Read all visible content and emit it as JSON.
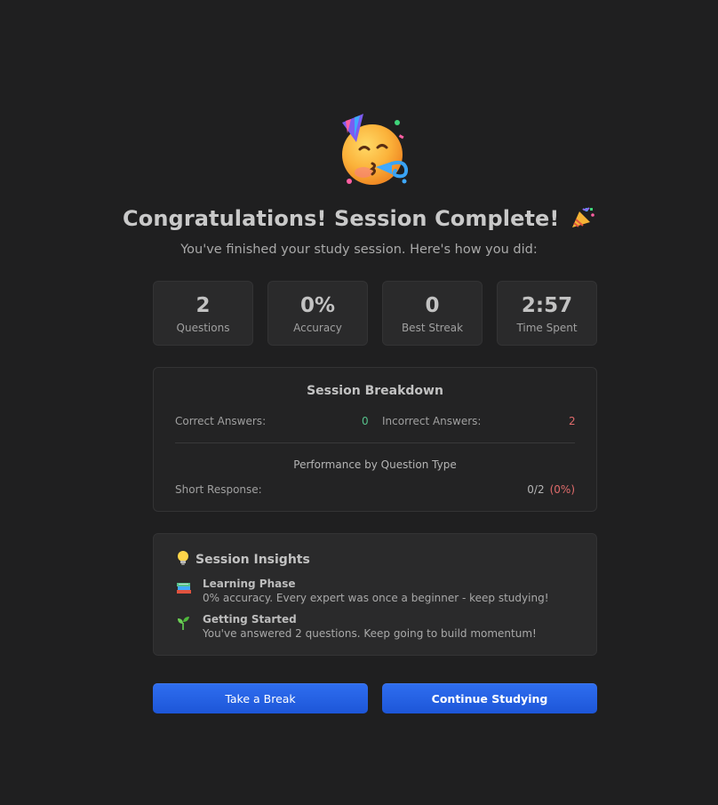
{
  "colors": {
    "background": "#1f1f20",
    "card": "#2a2a2b",
    "accent_blue": "#2563eb",
    "correct_green": "#56c08a",
    "incorrect_red": "#e06b6b"
  },
  "header": {
    "hero_icon": "partying-face-emoji",
    "title": "Congratulations! Session Complete!",
    "title_icon": "party-popper-emoji",
    "subtitle": "You've finished your study session. Here's how you did:"
  },
  "stats": [
    {
      "value": "2",
      "label": "Questions"
    },
    {
      "value": "0%",
      "label": "Accuracy"
    },
    {
      "value": "0",
      "label": "Best Streak"
    },
    {
      "value": "2:57",
      "label": "Time Spent"
    }
  ],
  "breakdown": {
    "title": "Session Breakdown",
    "correct_label": "Correct Answers:",
    "correct_value": "0",
    "incorrect_label": "Incorrect Answers:",
    "incorrect_value": "2",
    "performance_title": "Performance by Question Type",
    "types": [
      {
        "label": "Short Response:",
        "score": "0/2",
        "percent": "(0%)"
      }
    ]
  },
  "insights": {
    "icon": "lightbulb-icon",
    "title": "Session Insights",
    "items": [
      {
        "icon": "books-icon",
        "heading": "Learning Phase",
        "text": "0% accuracy. Every expert was once a beginner - keep studying!"
      },
      {
        "icon": "seedling-icon",
        "heading": "Getting Started",
        "text": "You've answered 2 questions. Keep going to build momentum!"
      }
    ]
  },
  "actions": {
    "break_label": "Take a Break",
    "continue_label": "Continue Studying"
  }
}
